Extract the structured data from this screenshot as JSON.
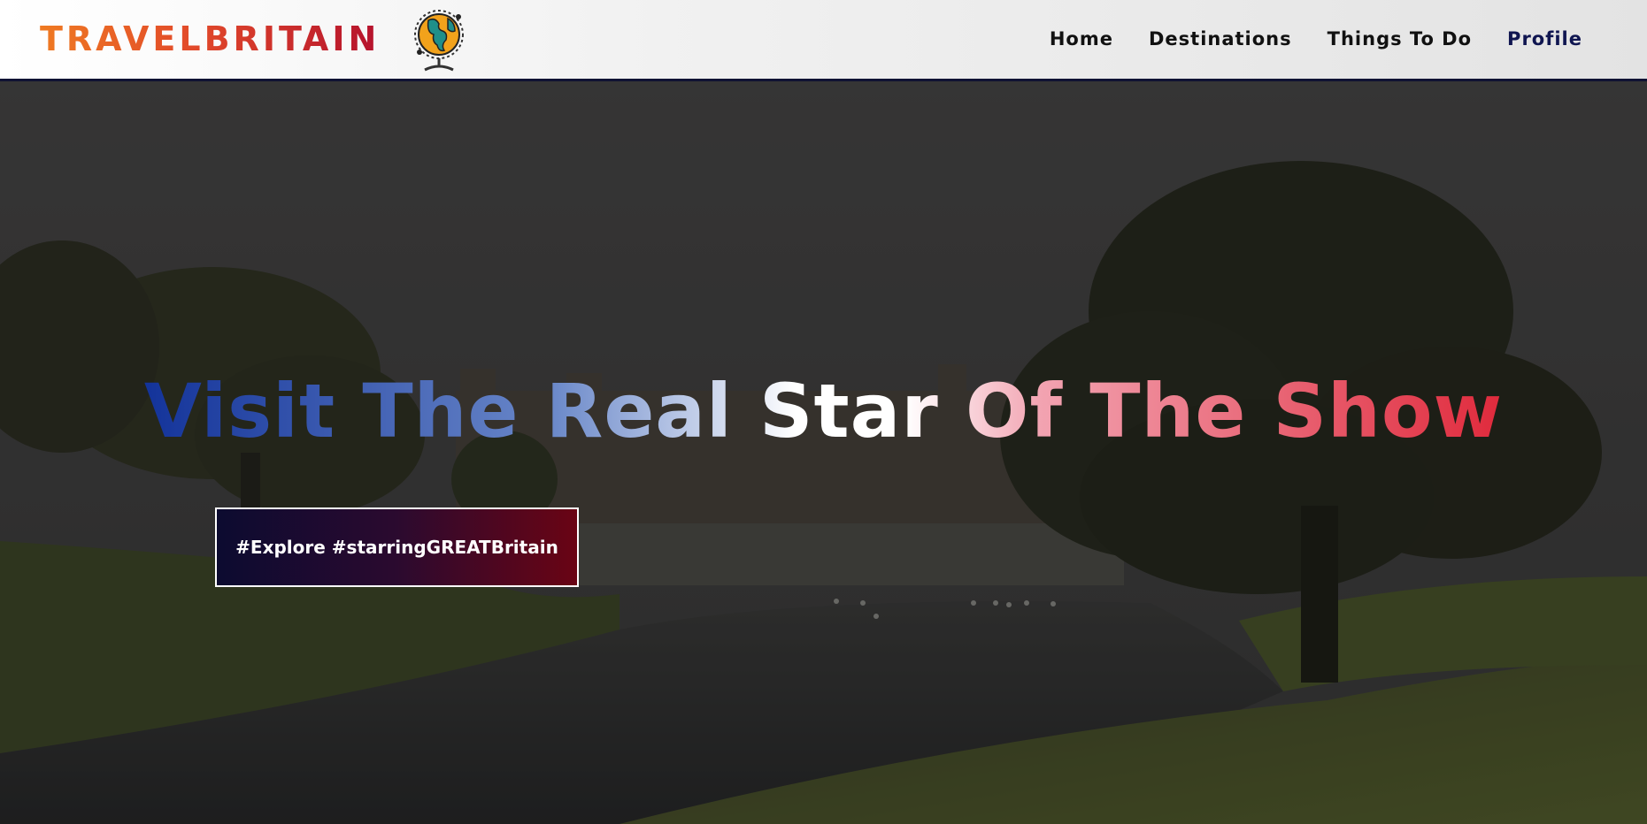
{
  "header": {
    "brand": "TRAVELBRITAIN",
    "logo_icon": "globe-icon",
    "nav": [
      {
        "label": "Home"
      },
      {
        "label": "Destinations"
      },
      {
        "label": "Things To Do"
      },
      {
        "label": "Profile"
      }
    ]
  },
  "hero": {
    "headline": "Visit The Real Star Of The Show",
    "cta_label": "#Explore #starringGREATBritain",
    "background_icon": "castle-landscape-image"
  },
  "colors": {
    "brand_gradient": [
      "#ef7a22",
      "#b5122d"
    ],
    "navbar_border": "#0f1233",
    "headline_gradient": [
      "#13339a",
      "#ffffff",
      "#e02a3c"
    ],
    "cta_gradient": [
      "#0c0b30",
      "#6a0414"
    ]
  }
}
